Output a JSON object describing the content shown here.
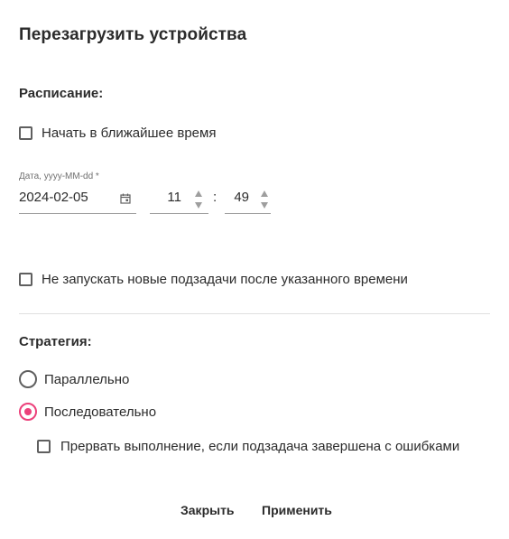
{
  "dialog": {
    "title": "Перезагрузить устройства"
  },
  "schedule": {
    "label": "Расписание:",
    "start_asap": {
      "label": "Начать в ближайшее время",
      "checked": false
    },
    "date": {
      "caption": "Дата, yyyy-MM-dd *",
      "value": "2024-02-05",
      "icon": "calendar-icon"
    },
    "time": {
      "hours": "11",
      "separator": ":",
      "minutes": "49"
    },
    "no_new_subtasks": {
      "label": "Не запускать новые подзадачи после указанного времени",
      "checked": false
    }
  },
  "strategy": {
    "label": "Стратегия:",
    "options": [
      {
        "label": "Параллельно",
        "selected": false
      },
      {
        "label": "Последовательно",
        "selected": true
      }
    ],
    "abort_on_error": {
      "label": "Прервать выполнение, если подзадача завершена с ошибками",
      "checked": false
    }
  },
  "actions": {
    "close_label": "Закрыть",
    "apply_label": "Применить"
  },
  "colors": {
    "accent": "#ec407a",
    "text": "#2b2b2b",
    "border": "#5f5f5f",
    "divider": "#e0e0e0"
  }
}
